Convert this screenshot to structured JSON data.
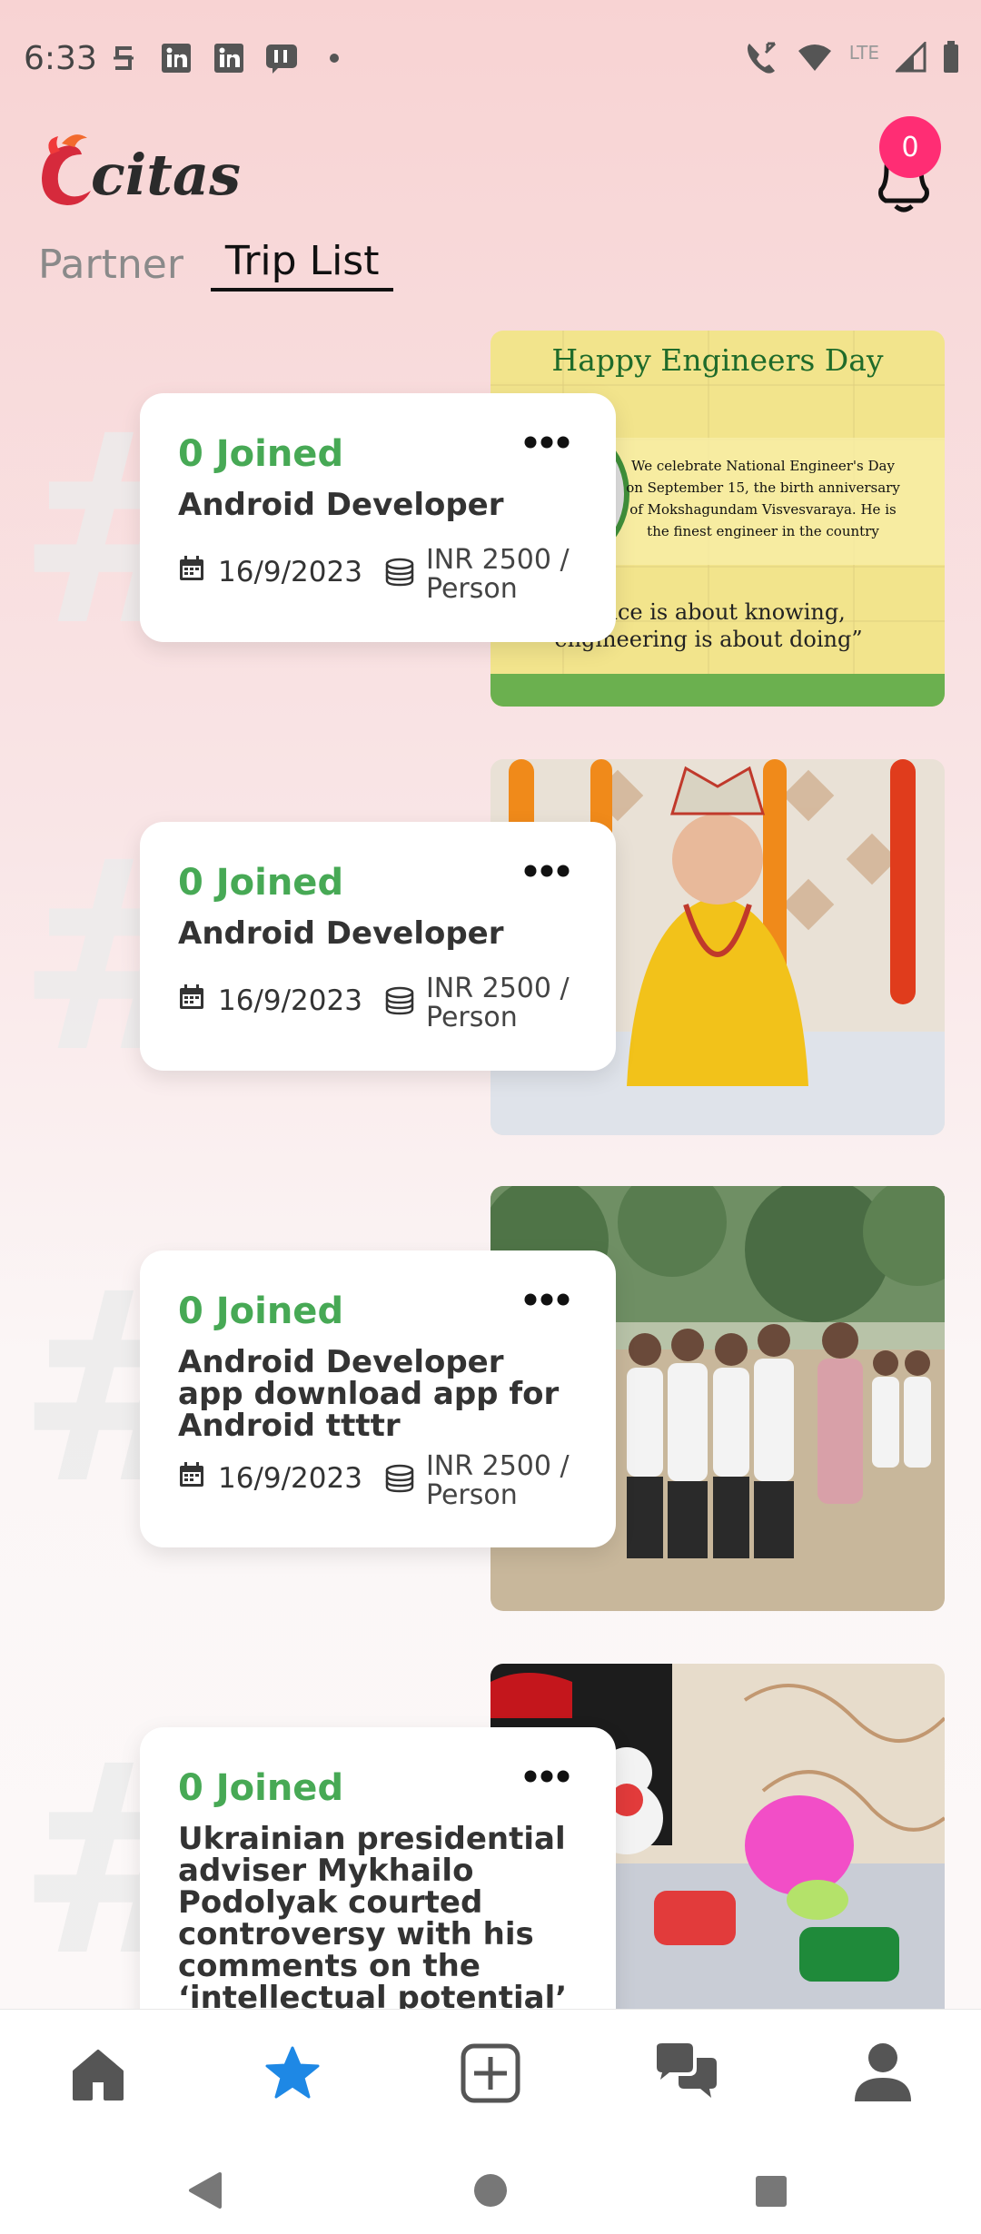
{
  "status_bar": {
    "time": "6:33",
    "lte": "LTE"
  },
  "app": {
    "logo_text": "citas",
    "notification_count": "0"
  },
  "tabs": [
    {
      "label": "Partner",
      "active": false
    },
    {
      "label": "Trip List",
      "active": true
    }
  ],
  "photo1": {
    "title": "Happy Engineers Day",
    "line1": "We celebrate National Engineer's Day",
    "line2": "on September 15, the birth anniversary",
    "line3": "of Mokshagundam Visvesvaraya. He is",
    "line4": "the finest engineer in the country",
    "quote1": "cience is about knowing,",
    "quote2": "engineering is about doing”"
  },
  "trips": [
    {
      "joined": "0 Joined",
      "title": "Android Developer",
      "date": "16/9/2023",
      "price": "INR 2500 / Person"
    },
    {
      "joined": "0 Joined",
      "title": "Android Developer",
      "date": "16/9/2023",
      "price": "INR 2500 / Person"
    },
    {
      "joined": "0 Joined",
      "title": "Android Developer app download app for Android ttttr",
      "date": "16/9/2023",
      "price": "INR 2500 / Person"
    },
    {
      "joined": "0 Joined",
      "title": "Ukrainian presidential adviser Mykhailo Podolyak courted controversy with his comments on the ‘intellectual potential’ of Indians and Chinese.",
      "date": "",
      "price": ""
    }
  ],
  "colors": {
    "accent_green": "#47a955",
    "badge_pink": "#ff2d74",
    "nav_active": "#1e88e5",
    "nav_inactive": "#555555"
  }
}
